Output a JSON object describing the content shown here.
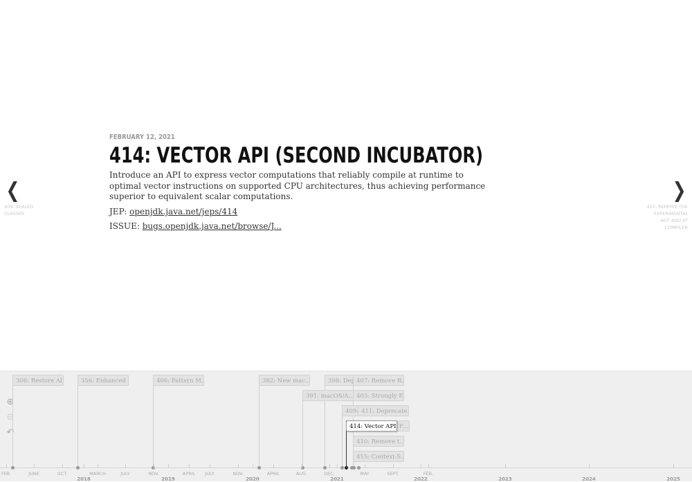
{
  "slide": {
    "date": "FEBRUARY 12, 2021",
    "headline": "414: VECTOR API (SECOND INCUBATOR)",
    "description": "Introduce an API to express vector computations that reliably compile at runtime to optimal vector instructions on supported CPU architectures, thus achieving performance superior to equivalent scalar computations.",
    "jep_label": "JEP:",
    "jep_link": "openjdk.java.net/jeps/414",
    "issue_label": "ISSUE:",
    "issue_link": "bugs.openjdk.java.net/browse/J..."
  },
  "nav": {
    "prev_arrow": "❮",
    "prev_label": "409: SEALED CLASSES",
    "next_arrow": "❯",
    "next_label": "410: REMOVE THE EXPERIMENTAL AOT AND JIT COMPILER"
  },
  "timeline": {
    "zoom_in_icon": "⊕",
    "zoom_out_icon": "⊖",
    "back_icon": "↶",
    "markers": [
      "306: Restore Al...",
      "356: Enhanced ...",
      "406: Pattern M...",
      "382: New mac...",
      "398: Depr",
      "407: Remove R...",
      "391: macOS/A...",
      "403: Strongly E...",
      "409:",
      "411: Deprecate...",
      "414: Vector API...",
      "F...",
      "410: Remove t...",
      "415: Context-S..."
    ],
    "month_labels": [
      "FEB.",
      "JUNE",
      "OCT.",
      "MARCH",
      "JULY",
      "NOV.",
      "APRIL",
      "JULY",
      "NOV.",
      "APRIL",
      "AUG.",
      "DEC.",
      "MAY",
      "SEPT.",
      "FEB."
    ],
    "year_labels": [
      "2018",
      "2019",
      "2020",
      "2021",
      "2022",
      "2023",
      "2024",
      "2025"
    ]
  }
}
